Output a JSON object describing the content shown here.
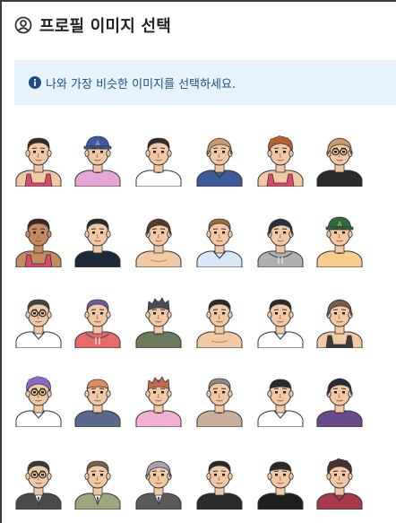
{
  "header": {
    "title": "프로필 이미지 선택",
    "icon": "user-circle-icon"
  },
  "info": {
    "text": "나와 가장 비슷한 이미지를 선택하세요.",
    "icon": "info-icon",
    "bg": "#e6f3fd",
    "color": "#1d4f86"
  },
  "avatars": [
    {
      "label": "avatar-1",
      "hair": "#3b2a22",
      "hairStyle": "short",
      "skin": "#f1c9a5",
      "shirt": "#f1c9a5",
      "shirtStyle": "tank",
      "tankColor": "#d94a6a",
      "acc": "none"
    },
    {
      "label": "avatar-2",
      "hair": "#2a2a2a",
      "hairStyle": "cap",
      "capColor": "#3c5aa8",
      "skin": "#f1c9a5",
      "shirt": "#e6a6d6",
      "shirtStyle": "tee",
      "acc": "cap"
    },
    {
      "label": "avatar-3",
      "hair": "#3b2a22",
      "hairStyle": "short",
      "skin": "#f1c9a5",
      "shirt": "#ffffff",
      "shirtStyle": "tee",
      "acc": "none"
    },
    {
      "label": "avatar-4",
      "hair": "#c89a66",
      "hairStyle": "long",
      "skin": "#f1c9a5",
      "shirt": "#3d5a9a",
      "shirtStyle": "collar",
      "acc": "none"
    },
    {
      "label": "avatar-5",
      "hair": "#b2622f",
      "hairStyle": "curly",
      "skin": "#f1c9a5",
      "shirt": "#f1c9a5",
      "shirtStyle": "tank",
      "tankColor": "#d94a6a",
      "acc": "none"
    },
    {
      "label": "avatar-6",
      "hair": "#c89a66",
      "hairStyle": "long",
      "skin": "#f1c9a5",
      "shirt": "#2a2a2a",
      "shirtStyle": "tee",
      "acc": "glasses"
    },
    {
      "label": "avatar-7",
      "hair": "#3b2a22",
      "hairStyle": "short",
      "skin": "#c68a62",
      "shirt": "#c68a62",
      "shirtStyle": "tank",
      "tankColor": "#d94a6a",
      "acc": "none"
    },
    {
      "label": "avatar-8",
      "hair": "#2a2a2a",
      "hairStyle": "short",
      "skin": "#f1c9a5",
      "shirt": "#1e2a3a",
      "shirtStyle": "tee",
      "acc": "none"
    },
    {
      "label": "avatar-9",
      "hair": "#5a3a22",
      "hairStyle": "long",
      "skin": "#f1c9a5",
      "shirt": "#f1c9a5",
      "shirtStyle": "bare",
      "acc": "none"
    },
    {
      "label": "avatar-10",
      "hair": "#9a6a3a",
      "hairStyle": "short",
      "skin": "#f1c9a5",
      "shirt": "#d8e8f8",
      "shirtStyle": "collar",
      "acc": "none"
    },
    {
      "label": "avatar-11",
      "hair": "#2a3040",
      "hairStyle": "long",
      "skin": "#f1c9a5",
      "shirt": "#b0b0b0",
      "shirtStyle": "hoodie",
      "acc": "none"
    },
    {
      "label": "avatar-12",
      "hair": "#2a2a2a",
      "hairStyle": "cap",
      "capColor": "#2f6a3a",
      "skin": "#f1c9a5",
      "shirt": "#f8cc8a",
      "shirtStyle": "tee",
      "acc": "cap"
    },
    {
      "label": "avatar-13",
      "hair": "#3b4a38",
      "hairStyle": "short",
      "skin": "#f1c9a5",
      "shirt": "#ffffff",
      "shirtStyle": "collar",
      "acc": "glasses"
    },
    {
      "label": "avatar-14",
      "hair": "#6a5aa8",
      "hairStyle": "short",
      "skin": "#f1c9a5",
      "shirt": "#e86a6a",
      "shirtStyle": "hoodie",
      "acc": "none"
    },
    {
      "label": "avatar-15",
      "hair": "#4a4a5a",
      "hairStyle": "spiky",
      "skin": "#f1c9a5",
      "shirt": "#6a7a5a",
      "shirtStyle": "tee",
      "acc": "none"
    },
    {
      "label": "avatar-16",
      "hair": "#2a2a2a",
      "hairStyle": "short",
      "skin": "#f1c9a5",
      "shirt": "#f1c9a5",
      "shirtStyle": "bare",
      "acc": "none"
    },
    {
      "label": "avatar-17",
      "hair": "#2a2a2a",
      "hairStyle": "short",
      "skin": "#f1c9a5",
      "shirt": "#ffffff",
      "shirtStyle": "collar",
      "acc": "none"
    },
    {
      "label": "avatar-18",
      "hair": "#7a5a44",
      "hairStyle": "long",
      "skin": "#f1c9a5",
      "shirt": "#3a3a3a",
      "shirtStyle": "tank",
      "tankColor": "#3a3a3a",
      "acc": "none"
    },
    {
      "label": "avatar-19",
      "hair": "#8a6ac8",
      "hairStyle": "curly",
      "skin": "#f1c9a5",
      "shirt": "#ffffff",
      "shirtStyle": "collar",
      "acc": "glasses"
    },
    {
      "label": "avatar-20",
      "hair": "#d8905a",
      "hairStyle": "buzz",
      "skin": "#f1c9a5",
      "shirt": "#5a6a8a",
      "shirtStyle": "tee",
      "acc": "none"
    },
    {
      "label": "avatar-21",
      "hair": "#c86a4a",
      "hairStyle": "spiky",
      "skin": "#f1c9a5",
      "shirt": "#f4b0d0",
      "shirtStyle": "tee",
      "acc": "none"
    },
    {
      "label": "avatar-22",
      "hair": "#8a8a8a",
      "hairStyle": "short",
      "skin": "#f1c9a5",
      "shirt": "#c8b09a",
      "shirtStyle": "tee",
      "acc": "none"
    },
    {
      "label": "avatar-23",
      "hair": "#2a2a2a",
      "hairStyle": "buzz",
      "skin": "#f1c9a5",
      "shirt": "#ffffff",
      "shirtStyle": "collar",
      "acc": "none"
    },
    {
      "label": "avatar-24",
      "hair": "#2a2a3a",
      "hairStyle": "long",
      "skin": "#f1c9a5",
      "shirt": "#6a4a8a",
      "shirtStyle": "tee",
      "acc": "none"
    },
    {
      "label": "avatar-25",
      "hair": "#3a3a3a",
      "hairStyle": "short",
      "skin": "#f1c9a5",
      "shirt": "#4a4a4a",
      "shirtStyle": "suit",
      "acc": "glasses"
    },
    {
      "label": "avatar-26",
      "hair": "#7a6044",
      "hairStyle": "short",
      "skin": "#f1c9a5",
      "shirt": "#9aa87a",
      "shirtStyle": "suit",
      "acc": "none"
    },
    {
      "label": "avatar-27",
      "hair": "#a8a0b0",
      "hairStyle": "long",
      "skin": "#f1c9a5",
      "shirt": "#5a5a5a",
      "shirtStyle": "suit",
      "acc": "none"
    },
    {
      "label": "avatar-28",
      "hair": "#2a2a2a",
      "hairStyle": "short",
      "skin": "#f1c9a5",
      "shirt": "#2a2a2a",
      "shirtStyle": "tee",
      "acc": "none"
    },
    {
      "label": "avatar-29",
      "hair": "#2a2a2a",
      "hairStyle": "buzz",
      "skin": "#f1c9a5",
      "shirt": "#1e1e1e",
      "shirtStyle": "tee",
      "acc": "none"
    },
    {
      "label": "avatar-30",
      "hair": "#4a3030",
      "hairStyle": "curly",
      "skin": "#f1c9a5",
      "shirt": "#a83a4a",
      "shirtStyle": "collar",
      "acc": "none"
    }
  ]
}
